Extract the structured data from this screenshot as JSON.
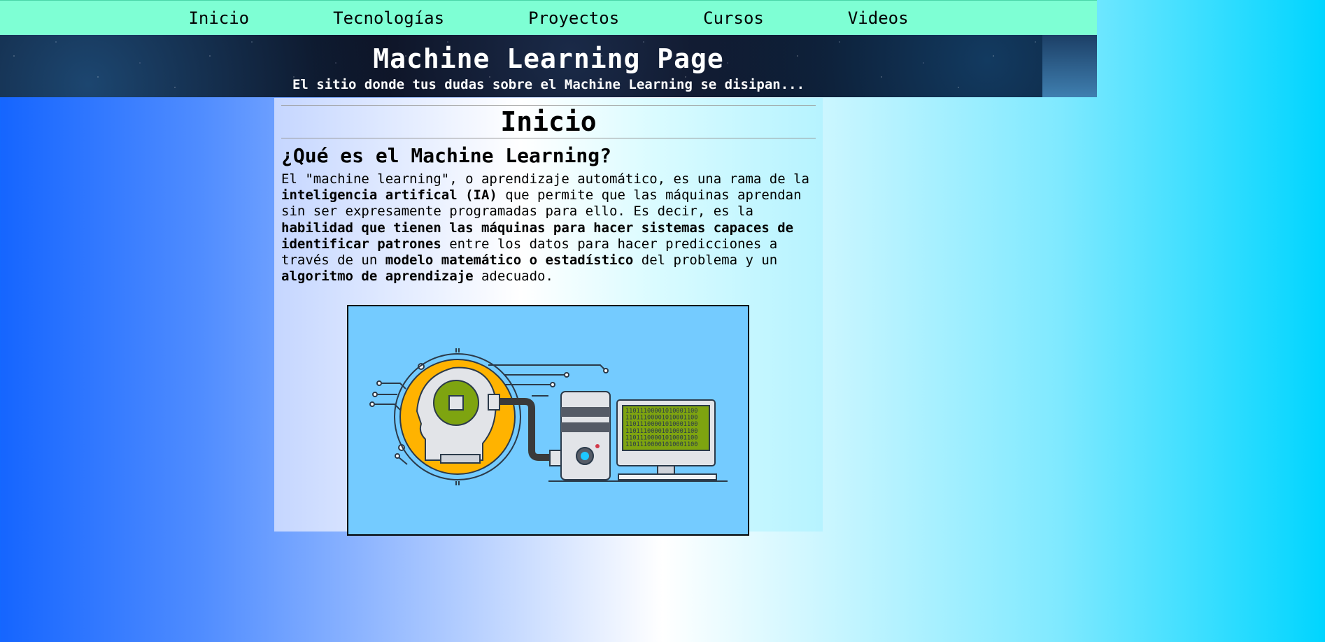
{
  "nav": {
    "items": [
      "Inicio",
      "Tecnologías",
      "Proyectos",
      "Cursos",
      "Videos"
    ]
  },
  "header": {
    "title": "Machine Learning Page",
    "subtitle": "El sitio donde tus dudas sobre el Machine Learning se disipan..."
  },
  "main": {
    "heading": "Inicio",
    "subheading": "¿Qué es el Machine Learning?",
    "paragraph": [
      {
        "t": "  El \"machine learning\", o aprendizaje automático, es una rama de la ",
        "b": false
      },
      {
        "t": "inteligencia artifical (IA)",
        "b": true
      },
      {
        "t": " que permite que las máquinas aprendan sin ser expresamente programadas para ello. Es decir, es la ",
        "b": false
      },
      {
        "t": "habilidad que tienen las máquinas para hacer sistemas capaces de identificar patrones",
        "b": true
      },
      {
        "t": " entre los datos para hacer predicciones a través de un ",
        "b": false
      },
      {
        "t": "modelo matemático o estadístico",
        "b": true
      },
      {
        "t": " del problema y un ",
        "b": false
      },
      {
        "t": "algoritmo de aprendizaje",
        "b": true
      },
      {
        "t": " adecuado.",
        "b": false
      }
    ],
    "figure": {
      "binary": [
        "11011100001010001100",
        "11011100001010001100",
        "11011100001010001100",
        "11011100001010001100",
        "11011100001010001100",
        "11011100001010001100"
      ]
    }
  },
  "colors": {
    "nav_bg": "#7effd4",
    "figure_bg": "#74cbff",
    "brain_orange": "#ffb300",
    "screen_green": "#7ea410"
  }
}
